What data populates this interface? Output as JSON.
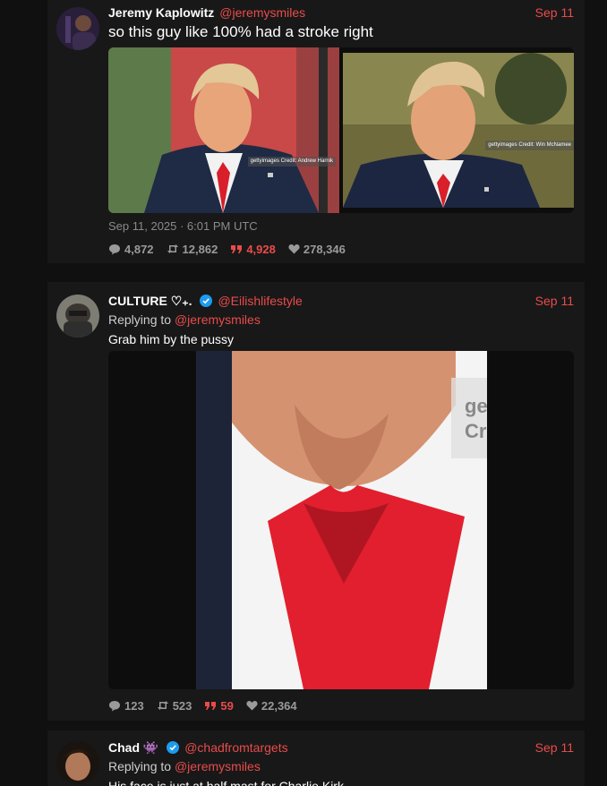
{
  "tweets": [
    {
      "name": "Jeremy Kaplowitz",
      "handle": "@jeremysmiles",
      "date": "Sep 11",
      "text": "so this guy like 100% had a stroke right",
      "photo_labels": [
        "gettyimages Credit: Andrew Harnik",
        "gettyimages Credit: Win McNamee"
      ],
      "timestamp": "Sep 11, 2025 · 6:01 PM UTC",
      "stats": {
        "replies": "4,872",
        "retweets": "12,862",
        "quotes": "4,928",
        "likes": "278,346"
      }
    },
    {
      "name": "CULTURE ♡₊.",
      "handle": "@Eilishlifestyle",
      "date": "Sep 11",
      "reply_prefix": "Replying to",
      "reply_to": "@jeremysmiles",
      "text": "Grab him by the pussy",
      "photo_watermark": "ge Cr",
      "stats": {
        "replies": "123",
        "retweets": "523",
        "quotes": "59",
        "likes": "22,364"
      }
    },
    {
      "name": "Chad 👾",
      "handle": "@chadfromtargets",
      "date": "Sep 11",
      "reply_prefix": "Replying to",
      "reply_to": "@jeremysmiles",
      "text": "His face is just at half mast for Charlie Kirk"
    }
  ],
  "icons": {
    "reply": "comment-icon",
    "retweet": "retweet-icon",
    "quote": "quote-icon",
    "like": "heart-icon",
    "verified": "verified-badge-icon"
  },
  "colors": {
    "accent": "#e94b4b",
    "verified": "#1d9bf0",
    "background": "#101010",
    "card": "#181818"
  }
}
